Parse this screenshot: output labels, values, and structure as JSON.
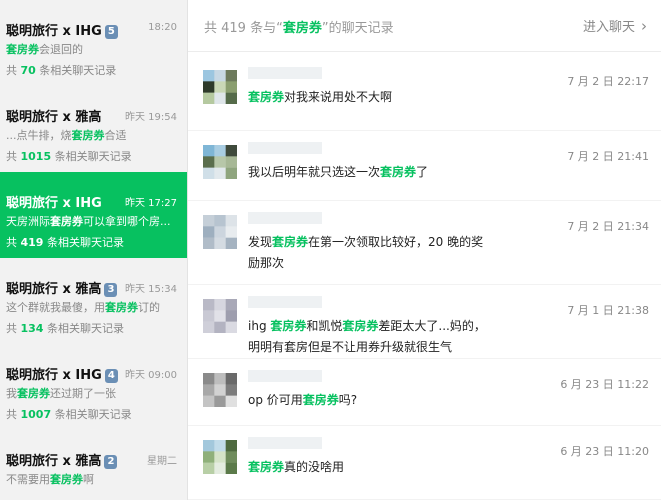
{
  "sidebar": {
    "conversations": [
      {
        "title": "聪明旅行 x IHG",
        "badge": "5",
        "time": "18:20",
        "snippet_pre": "",
        "snippet_hl": "套房券",
        "snippet_post": "会退回的",
        "count_pre": "共 ",
        "count_num": "70",
        "count_post": " 条相关聊天记录",
        "active": false
      },
      {
        "title": "聪明旅行 x 雅高",
        "badge": "",
        "time": "昨天 19:54",
        "snippet_pre": "...点牛排，烧",
        "snippet_hl": "套房券",
        "snippet_post": "合适",
        "count_pre": "共 ",
        "count_num": "1015",
        "count_post": " 条相关聊天记录",
        "active": false
      },
      {
        "title": "聪明旅行 x IHG",
        "badge": "",
        "time": "昨天 17:27",
        "snippet_pre": "天房洲际",
        "snippet_hl": "套房券",
        "snippet_post": "可以拿到哪个房...",
        "count_pre": "共 ",
        "count_num": "419",
        "count_post": " 条相关聊天记录",
        "active": true
      },
      {
        "title": "聪明旅行 x 雅高",
        "badge": "3",
        "time": "昨天 15:34",
        "snippet_pre": "这个群就我最傻，用",
        "snippet_hl": "套房券",
        "snippet_post": "订的",
        "count_pre": "共 ",
        "count_num": "134",
        "count_post": " 条相关聊天记录",
        "active": false
      },
      {
        "title": "聪明旅行 x IHG",
        "badge": "4",
        "time": "昨天 09:00",
        "snippet_pre": "我",
        "snippet_hl": "套房券",
        "snippet_post": "还过期了一张",
        "count_pre": "共 ",
        "count_num": "1007",
        "count_post": " 条相关聊天记录",
        "active": false
      },
      {
        "title": "聪明旅行 x 雅高",
        "badge": "2",
        "time": "星期二",
        "snippet_pre": "不需要用",
        "snippet_hl": "套房券",
        "snippet_post": "啊",
        "count_pre": "",
        "count_num": "",
        "count_post": "",
        "active": false
      }
    ]
  },
  "header": {
    "title_pre": "共 419 条与“",
    "title_query": "套房券",
    "title_post": "”的聊天记录",
    "enter_chat": "进入聊天",
    "chevron": "›"
  },
  "messages": [
    {
      "time": "7 月 2 日 22:17",
      "line1_pre": "",
      "line1_hl": "套房券",
      "line1_post": "对我来说用处不大啊",
      "line1_hl2": "",
      "line1_post2": "",
      "line2": ""
    },
    {
      "time": "7 月 2 日 21:41",
      "line1_pre": "我以后明年就只选这一次",
      "line1_hl": "套房券",
      "line1_post": "了",
      "line1_hl2": "",
      "line1_post2": "",
      "line2": ""
    },
    {
      "time": "7 月 2 日 21:34",
      "line1_pre": "发现",
      "line1_hl": "套房券",
      "line1_post": "在第一次领取比较好，20 晚的奖",
      "line1_hl2": "",
      "line1_post2": "",
      "line2": "励那次"
    },
    {
      "time": "7 月 1 日 21:38",
      "line1_pre": "ihg ",
      "line1_hl": "套房券",
      "line1_post": "和凯悦",
      "line1_hl2": "套房券",
      "line1_post2": "差距太大了...妈的，",
      "line2": "明明有套房但是不让用券升级就很生气"
    },
    {
      "time": "6 月 23 日 11:22",
      "line1_pre": "op 价可用",
      "line1_hl": "套房券",
      "line1_post": "吗?",
      "line1_hl2": "",
      "line1_post2": "",
      "line2": ""
    },
    {
      "time": "6 月 23 日 11:20",
      "line1_pre": "",
      "line1_hl": "套房券",
      "line1_post": "真的没啥用",
      "line1_hl2": "",
      "line1_post2": "",
      "line2": ""
    }
  ],
  "colors": {
    "accent": "#07c160",
    "badge": "#6b8fb5",
    "sidebar_bg": "#f2f2f2"
  }
}
